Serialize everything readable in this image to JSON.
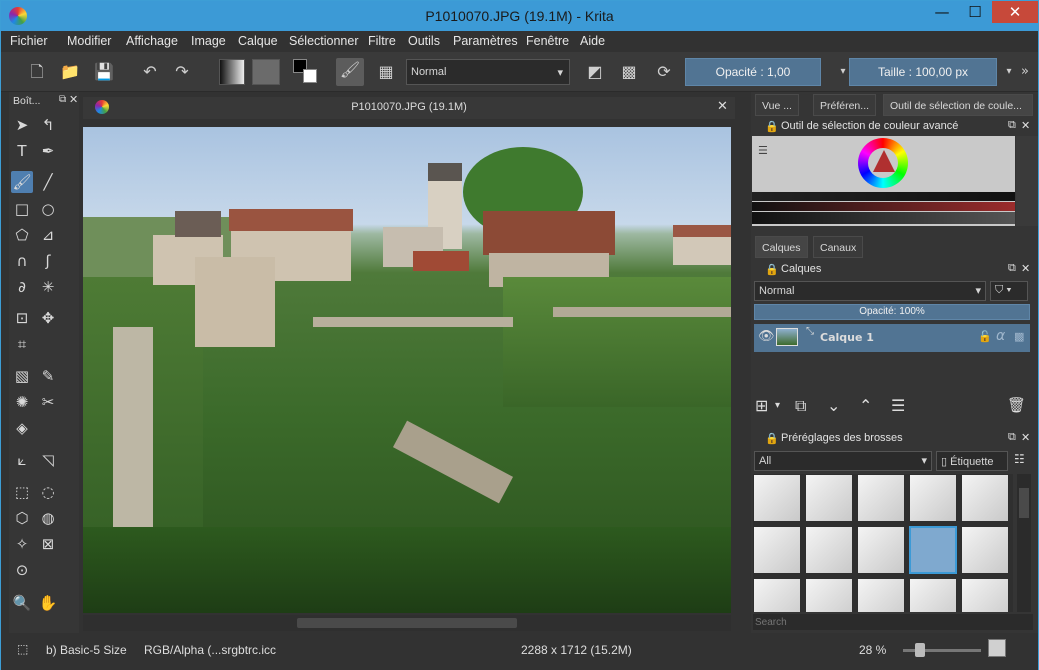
{
  "window": {
    "title": "P1010070.JPG (19.1M)  - Krita",
    "min": "—",
    "max": "☐",
    "close": "✕"
  },
  "menu": [
    "Fichier",
    "Modifier",
    "Affichage",
    "Image",
    "Calque",
    "Sélectionner",
    "Filtre",
    "Outils",
    "Paramètres",
    "Fenêtre",
    "Aide"
  ],
  "toolbar": {
    "blend_mode": "Normal",
    "opacity_label": "Opacité :",
    "opacity_value": "1,00",
    "size_label": "Taille :",
    "size_value": "100,00 px",
    "more": "»"
  },
  "toolbox": {
    "title": "Boît..."
  },
  "canvas": {
    "title": "P1010070.JPG (19.1M)"
  },
  "right_tabs": [
    "Vue ...",
    "Préféren...",
    "Outil de sélection de coule..."
  ],
  "color_selector": {
    "title": "Outil de sélection de couleur avancé"
  },
  "layer_tabs": [
    "Calques",
    "Canaux"
  ],
  "layers": {
    "title": "Calques",
    "blend_mode": "Normal",
    "opacity": "Opacité:  100%",
    "items": [
      {
        "name": "Calque 1"
      }
    ]
  },
  "brushes": {
    "title": "Préréglages des brosses",
    "filter": "All",
    "tag_button": "Étiquette",
    "search_placeholder": "Search"
  },
  "status": {
    "brush": "b) Basic-5 Size",
    "color_space": "RGB/Alpha (...srgbtrc.icc",
    "dimensions": "2288 x 1712 (15.2M)",
    "zoom": "28 %"
  },
  "colors": {
    "accent": "#3c9ad6",
    "selection": "#4f7fb0",
    "panel": "#353535"
  }
}
